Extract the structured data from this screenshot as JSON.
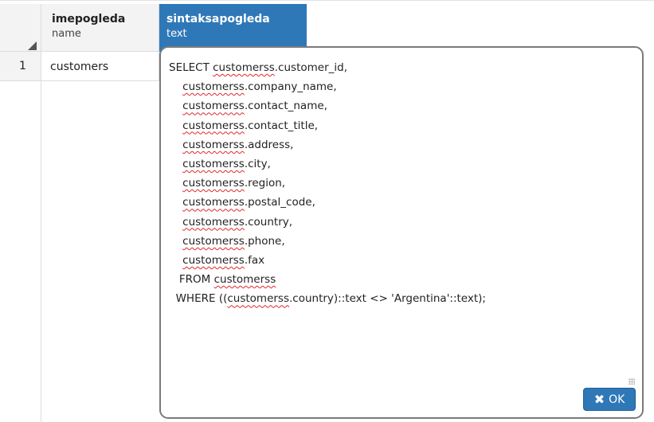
{
  "grid": {
    "columns": [
      {
        "name": "imepogleda",
        "type": "name"
      },
      {
        "name": "sintaksapogleda",
        "type": "text"
      }
    ],
    "rows": [
      {
        "num": "1",
        "imepogleda": "customers"
      }
    ]
  },
  "editor": {
    "lines": [
      [
        {
          "t": "SELECT "
        },
        {
          "t": "customerss",
          "sq": true
        },
        {
          "t": ".customer_id,"
        }
      ],
      [
        {
          "t": "    "
        },
        {
          "t": "customerss",
          "sq": true
        },
        {
          "t": ".company_name,"
        }
      ],
      [
        {
          "t": "    "
        },
        {
          "t": "customerss",
          "sq": true
        },
        {
          "t": ".contact_name,"
        }
      ],
      [
        {
          "t": "    "
        },
        {
          "t": "customerss",
          "sq": true
        },
        {
          "t": ".contact_title,"
        }
      ],
      [
        {
          "t": "    "
        },
        {
          "t": "customerss",
          "sq": true
        },
        {
          "t": ".address,"
        }
      ],
      [
        {
          "t": "    "
        },
        {
          "t": "customerss",
          "sq": true
        },
        {
          "t": ".city,"
        }
      ],
      [
        {
          "t": "    "
        },
        {
          "t": "customerss",
          "sq": true
        },
        {
          "t": ".region,"
        }
      ],
      [
        {
          "t": "    "
        },
        {
          "t": "customerss",
          "sq": true
        },
        {
          "t": ".postal_code,"
        }
      ],
      [
        {
          "t": "    "
        },
        {
          "t": "customerss",
          "sq": true
        },
        {
          "t": ".country,"
        }
      ],
      [
        {
          "t": "    "
        },
        {
          "t": "customerss",
          "sq": true
        },
        {
          "t": ".phone,"
        }
      ],
      [
        {
          "t": "    "
        },
        {
          "t": "customerss",
          "sq": true
        },
        {
          "t": ".fax"
        }
      ],
      [
        {
          "t": "   FROM "
        },
        {
          "t": "customerss",
          "sq": true
        }
      ],
      [
        {
          "t": "  WHERE (("
        },
        {
          "t": "customerss",
          "sq": true
        },
        {
          "t": ".country)::text <> 'Argentina'::text);"
        }
      ]
    ],
    "ok_label": "OK",
    "ok_icon": "close-icon"
  },
  "colors": {
    "header_selected": "#2f78b8",
    "header_bg": "#f3f3f3",
    "spell_underline": "#e0282c"
  }
}
